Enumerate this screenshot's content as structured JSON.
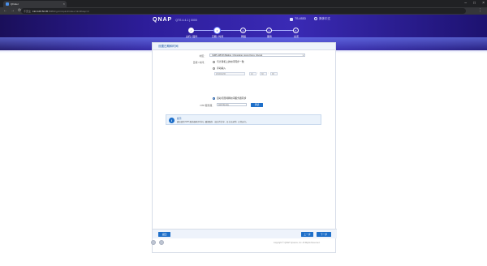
{
  "browser": {
    "tab_title": "Qfinder",
    "tab_close": "×",
    "window_controls": [
      "–",
      "□",
      "×"
    ],
    "nav_icons": [
      "←",
      "→",
      "⟳"
    ],
    "security_label": "不安全",
    "url_host": "192.168.50.95",
    "url_path": ":8080/cgi-bin/quick/index.html#step=2",
    "more_icon": "⋮"
  },
  "header": {
    "brand": "QNAP",
    "version": "QTS 4.4.1 | 0000",
    "device_label": "TS-453D",
    "language_label": "简体中文"
  },
  "steps": [
    {
      "number": "✓",
      "label": "主机 / 固件"
    },
    {
      "number": "2",
      "label": "日期 / 时间"
    },
    {
      "number": "3",
      "label": "网络"
    },
    {
      "number": "4",
      "label": "服务"
    },
    {
      "number": "5",
      "label": "总览"
    }
  ],
  "form": {
    "title": "设置日期和时间",
    "timezone_label": "时区：",
    "timezone_value": "(GMT+08:00) Beijing, Chongqing, Hong Kong, Urumqi",
    "datetime_label": "日期 / 时间：",
    "option_sync_pc": "与计算机上的时间同步一致",
    "option_manual": "手动输入",
    "date_value": "2019/10/30",
    "hour_value": "10",
    "minute_value": "30",
    "second_value": "00",
    "option_ntp": "自动与因特网时间服务器同步",
    "ntp_label": "NTP 服务器：",
    "ntp_value": "pool.ntp.org",
    "ntp_button": "测试"
  },
  "hint": {
    "icon": "i",
    "title": "提示",
    "text": "建议使用 NTP 服务器同步时间，确保服务（如文件共享、日志记录等）正常运行。"
  },
  "footer": {
    "back_button": "返回",
    "prev_button": "上一步",
    "next_button": "下一步",
    "copyright": "Copyright © QNAP Systems, Inc. All Rights Reserved."
  }
}
